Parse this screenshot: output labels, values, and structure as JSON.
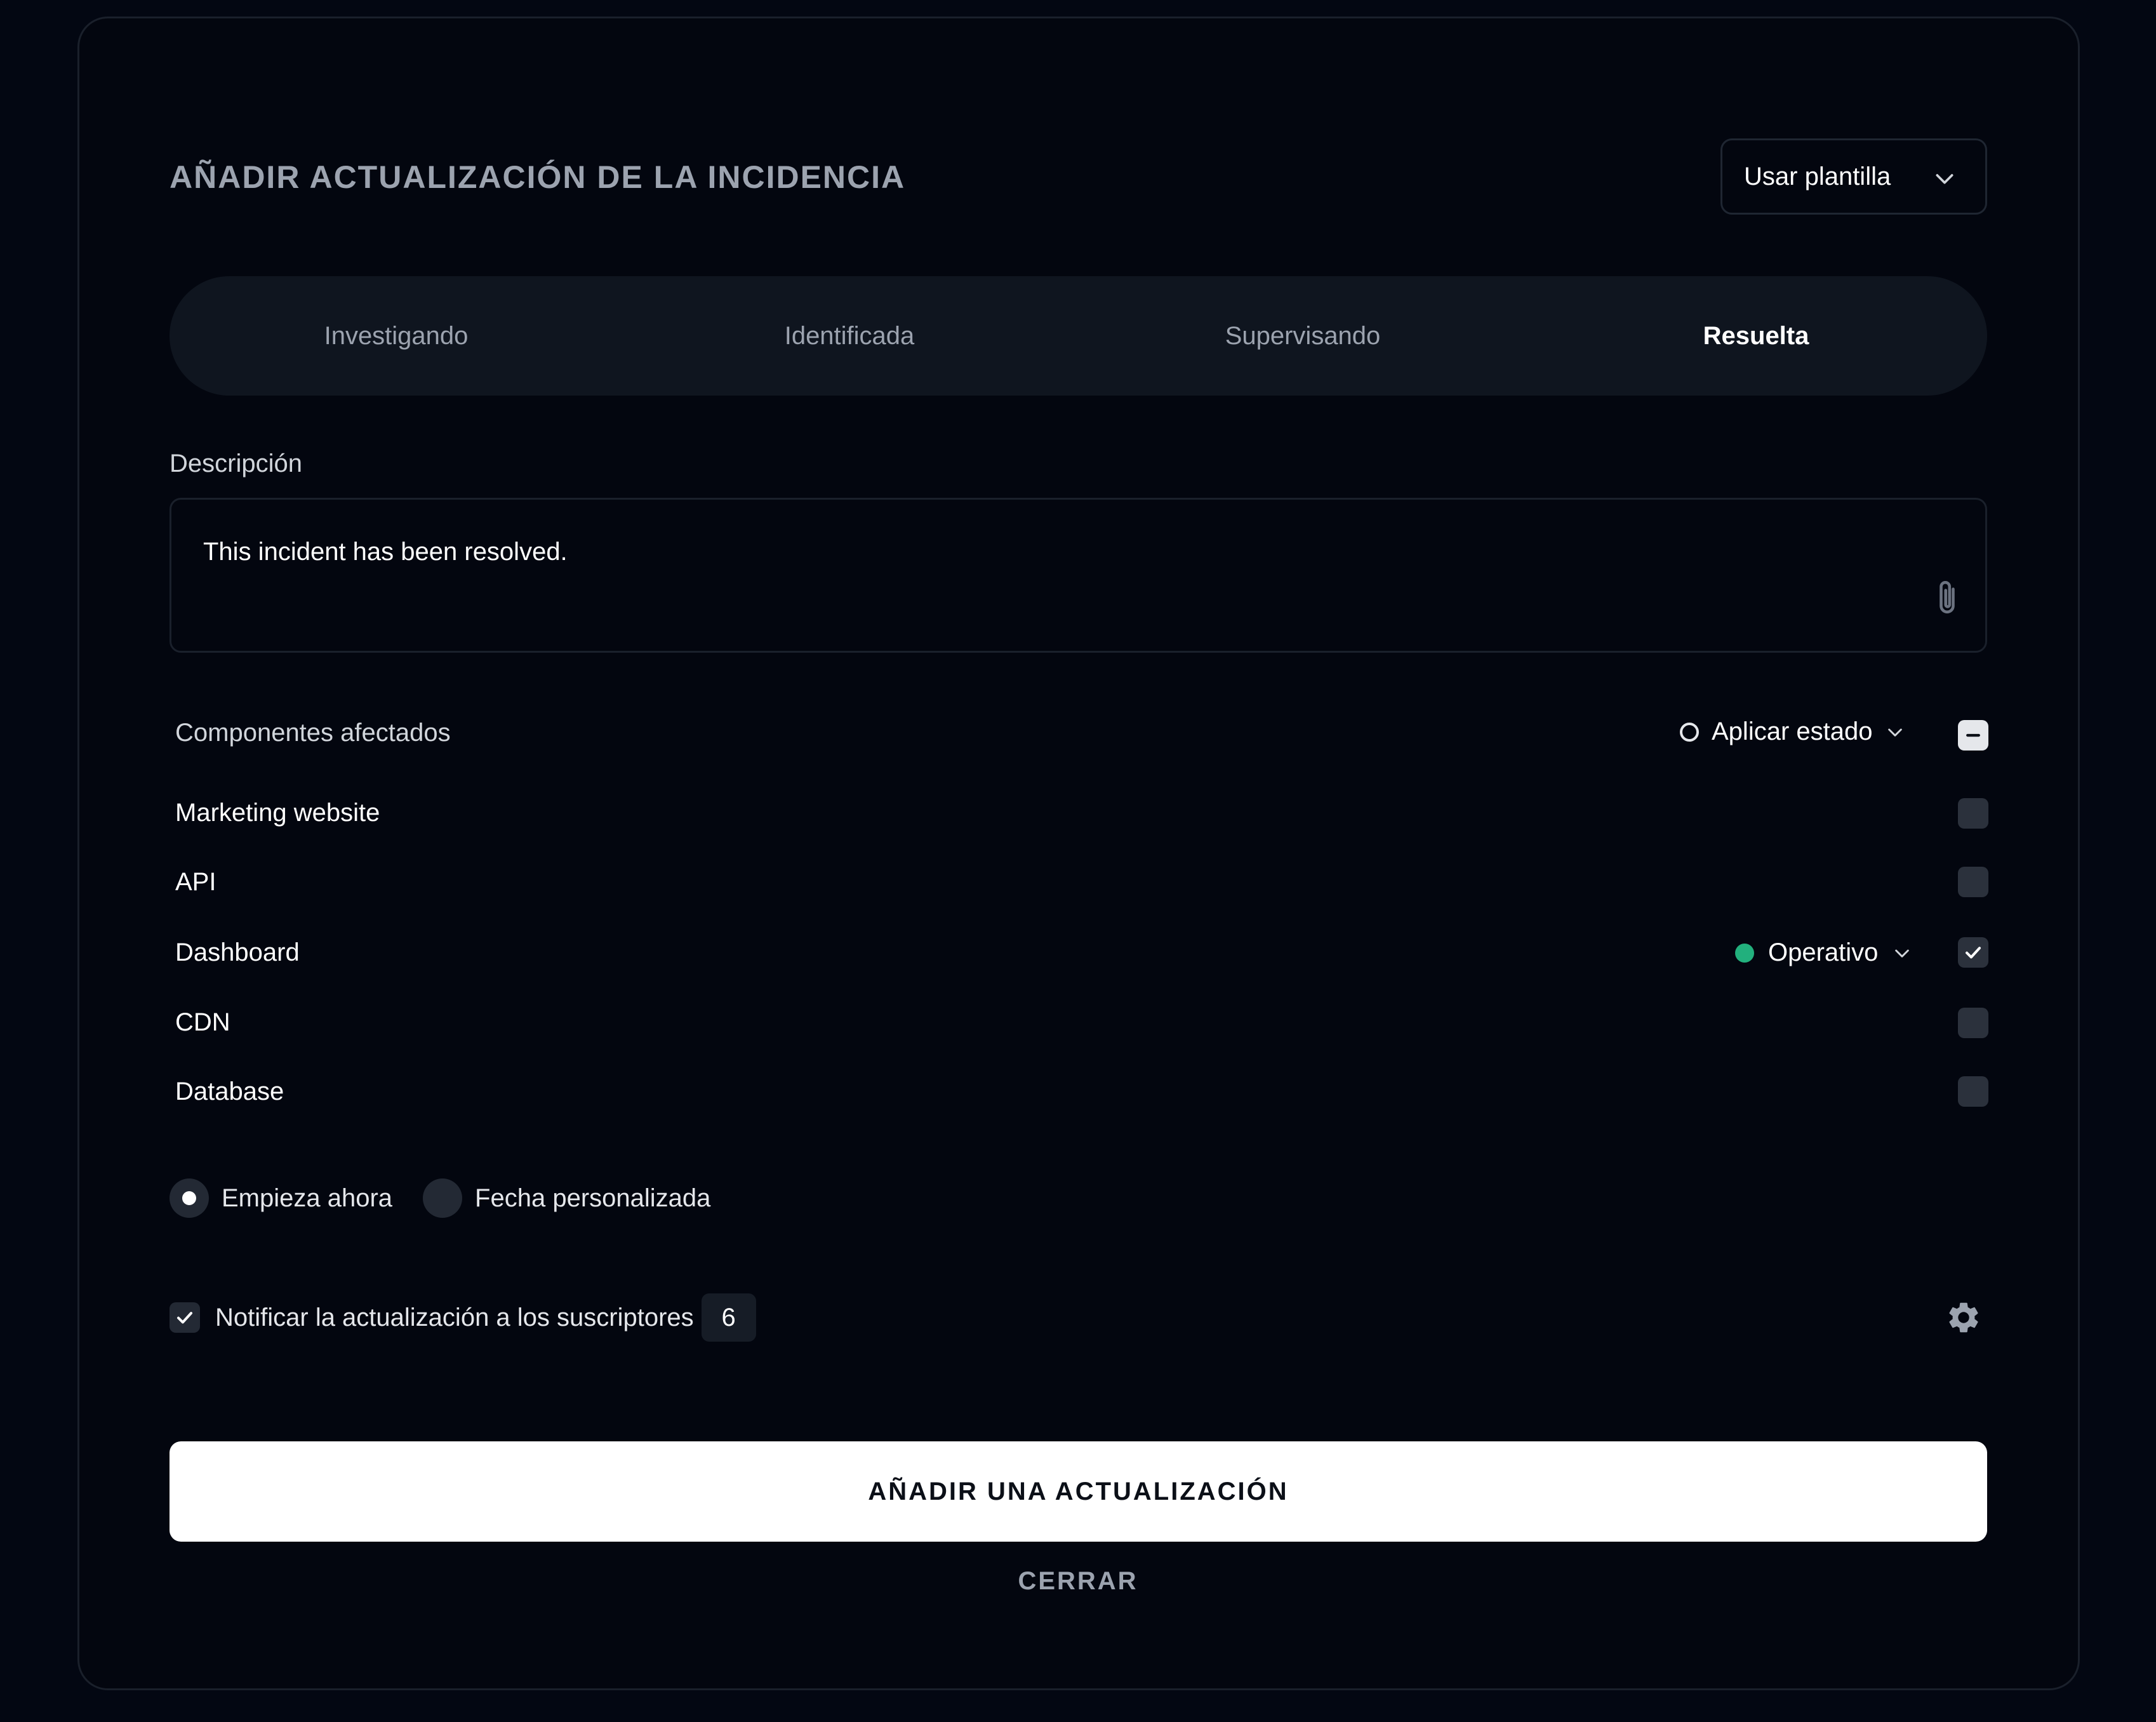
{
  "dialog": {
    "title": "AÑADIR ACTUALIZACIÓN DE LA INCIDENCIA",
    "template_button": "Usar plantilla"
  },
  "tabs": [
    {
      "label": "Investigando",
      "active": false
    },
    {
      "label": "Identificada",
      "active": false
    },
    {
      "label": "Supervisando",
      "active": false
    },
    {
      "label": "Resuelta",
      "active": true
    }
  ],
  "description": {
    "label": "Descripción",
    "value": "This incident has been resolved."
  },
  "components": {
    "header": "Componentes afectados",
    "apply_status": "Aplicar estado",
    "items": [
      {
        "name": "Marketing website",
        "checked": false
      },
      {
        "name": "API",
        "checked": false
      },
      {
        "name": "Dashboard",
        "checked": true,
        "status": "Operativo"
      },
      {
        "name": "CDN",
        "checked": false
      },
      {
        "name": "Database",
        "checked": false
      }
    ]
  },
  "timing": {
    "options": [
      {
        "label": "Empieza ahora",
        "selected": true
      },
      {
        "label": "Fecha personalizada",
        "selected": false
      }
    ]
  },
  "notify": {
    "label": "Notificar la actualización a los suscriptores",
    "checked": true,
    "count": "6"
  },
  "actions": {
    "submit": "AÑADIR UNA ACTUALIZACIÓN",
    "close": "CERRAR"
  },
  "colors": {
    "background": "#030712",
    "operational": "#22b07d",
    "primary_button": "#ffffff"
  }
}
